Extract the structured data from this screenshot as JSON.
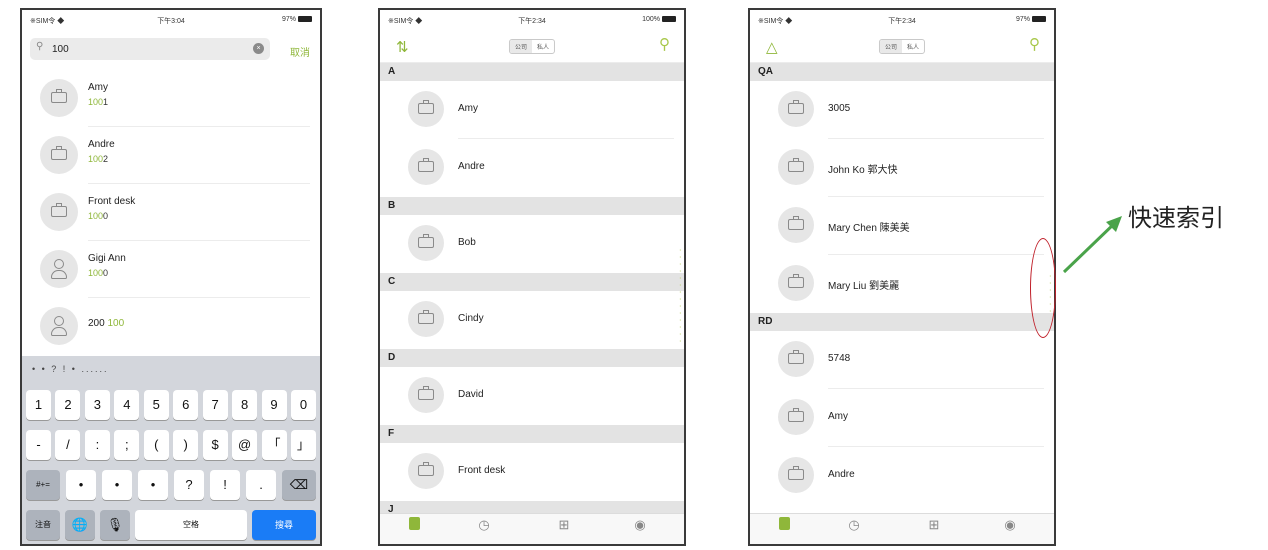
{
  "phone1": {
    "status": {
      "left": "※SIM令 ◆",
      "center": "下午3:04",
      "right": "97%"
    },
    "search": {
      "value": "100",
      "cancel": "取消"
    },
    "results": [
      {
        "name": "Amy",
        "match": "100",
        "rest": "1",
        "icon": "briefcase-icon"
      },
      {
        "name": "Andre",
        "match": "100",
        "rest": "2",
        "icon": "briefcase-icon"
      },
      {
        "name": "Front desk",
        "match": "100",
        "rest": "0",
        "icon": "briefcase-icon"
      },
      {
        "name": "Gigi Ann",
        "match": "100",
        "rest": "0",
        "icon": "person-icon"
      },
      {
        "name": "200",
        "match": "100",
        "icon": "person-icon"
      }
    ],
    "keyboard": {
      "predictions": "• • ? ! • ......",
      "row1": [
        "1",
        "2",
        "3",
        "4",
        "5",
        "6",
        "7",
        "8",
        "9",
        "0"
      ],
      "row2": [
        "-",
        "/",
        ":",
        ";",
        "(",
        ")",
        "$",
        "@",
        "「",
        "」"
      ],
      "row3": [
        "#+=",
        "•",
        "•",
        "•",
        "?",
        "!",
        ".",
        "⌫"
      ],
      "row4": {
        "switch": "注音",
        "globe": "🌐",
        "mic": "🎙",
        "space": "空格",
        "search": "搜尋"
      }
    }
  },
  "phone2": {
    "status": {
      "left": "※SIM令 ◆",
      "center": "下午2:34",
      "right": "100%"
    },
    "segments": [
      "公司",
      "私人"
    ],
    "sections": [
      {
        "letter": "A",
        "contacts": [
          "Amy",
          "Andre"
        ]
      },
      {
        "letter": "B",
        "contacts": [
          "Bob"
        ]
      },
      {
        "letter": "C",
        "contacts": [
          "Cindy"
        ]
      },
      {
        "letter": "D",
        "contacts": [
          "David"
        ]
      },
      {
        "letter": "F",
        "contacts": [
          "Front desk"
        ]
      },
      {
        "letter": "J",
        "contacts": []
      }
    ]
  },
  "phone3": {
    "status": {
      "left": "※SIM令 ◆",
      "center": "下午2:34",
      "right": "97%"
    },
    "segments": [
      "公司",
      "私人"
    ],
    "sections": [
      {
        "letter": "QA",
        "contacts": [
          "3005",
          "John Ko 郭大快",
          "Mary Chen 陳美美",
          "Mary Liu 劉美麗"
        ]
      },
      {
        "letter": "RD",
        "contacts": [
          "5748",
          "Amy",
          "Andre"
        ]
      }
    ]
  },
  "annotation": {
    "label": "快速索引",
    "arrow_color": "#4aa34a",
    "ring_color": "#c0202a"
  },
  "colors": {
    "accent": "#8fb73a",
    "keyboard_blue": "#1a7cf6"
  }
}
